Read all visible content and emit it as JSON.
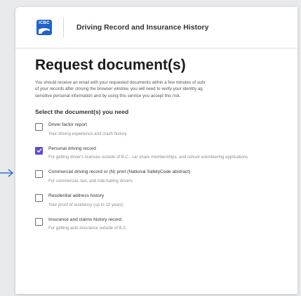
{
  "header": {
    "logo_text": "ICBC",
    "title": "Driving Record and Insurance History"
  },
  "main": {
    "page_title": "Request document(s)",
    "intro_lines": [
      "You should receive an email with your requested documents within a few minutes of subr",
      "of your records after closing the browser window, you will need to verify your identity ag",
      "sensitive personal information and by using this service you accept this risk."
    ],
    "section_label": "Select the document(s) you need"
  },
  "options": [
    {
      "title": "Driver factor report",
      "desc": "Your driving experience and crash history",
      "checked": false
    },
    {
      "title": "Personal driving record",
      "desc": "For getting driver's licences outside of B.C., car share memberships, and school volunteering applications",
      "checked": true
    },
    {
      "title": "Commercial driving record or (N) print (National SafetyCode abstract)",
      "desc": "For commercial, taxi, and ride-hailing drivers",
      "checked": false
    },
    {
      "title": "Residential address history",
      "desc": "Your proof of residency (up to 10 years)",
      "checked": false
    },
    {
      "title": "Insurance and claims history record",
      "desc": "For getting auto insurance outside of B.C.",
      "checked": false
    }
  ],
  "colors": {
    "accent": "#5a4bdb",
    "logo_blue": "#1e62c9",
    "arrow_blue": "#3a73d6"
  },
  "icons": {
    "arrow": "arrow-right-icon",
    "check": "checkmark-icon",
    "logo": "icbc-logo-icon"
  }
}
